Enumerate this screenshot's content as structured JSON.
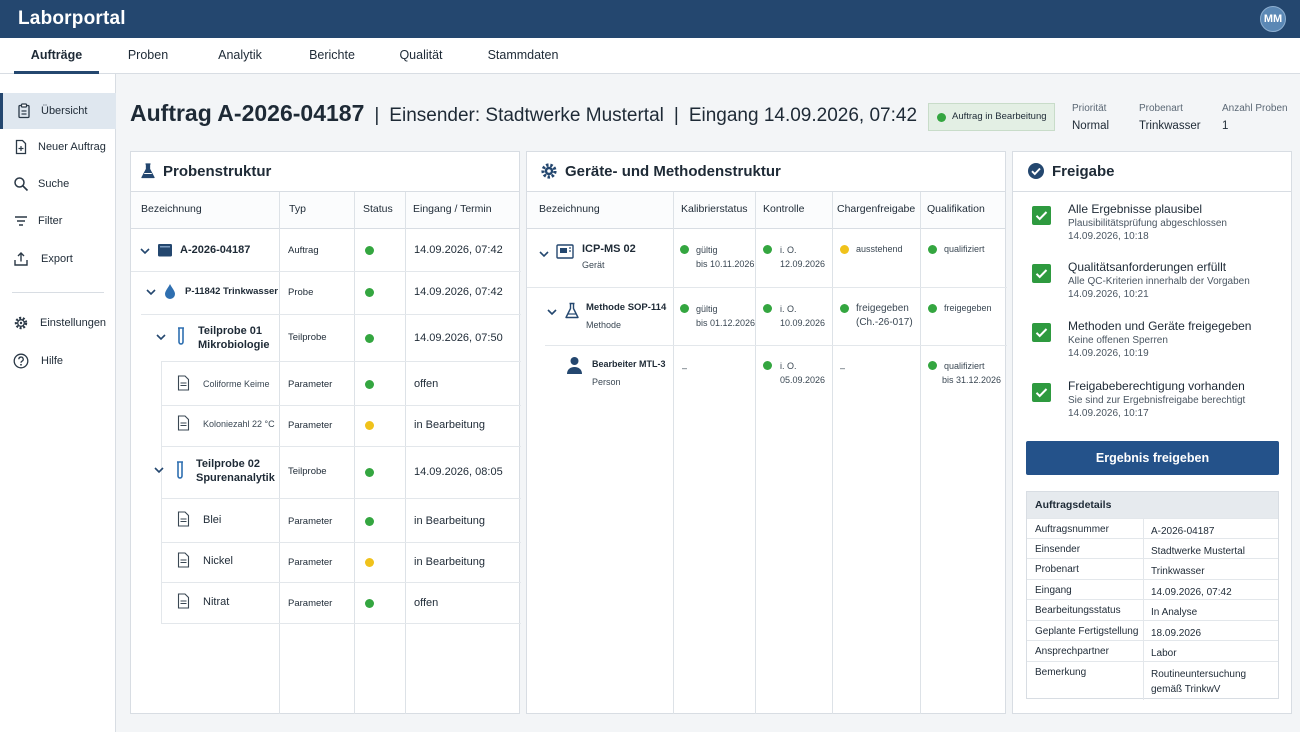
{
  "app": {
    "title": "Laborportal",
    "user_initials": "MM"
  },
  "nav": {
    "tabs": [
      {
        "label": "Aufträge"
      },
      {
        "label": "Proben"
      },
      {
        "label": "Analytik"
      },
      {
        "label": "Berichte"
      },
      {
        "label": "Qualität"
      },
      {
        "label": "Stammdaten"
      }
    ]
  },
  "sidebar": {
    "items": [
      {
        "label": "Übersicht",
        "icon": "clipboard-icon"
      },
      {
        "label": "Neuer Auftrag",
        "icon": "document-add-icon"
      },
      {
        "label": "Suche",
        "icon": "search-icon"
      },
      {
        "label": "Filter",
        "icon": "filter-icon"
      },
      {
        "label": "Export",
        "icon": "export-icon"
      },
      {
        "label": "Einstellungen",
        "icon": "gear-icon"
      },
      {
        "label": "Hilfe",
        "icon": "help-icon"
      }
    ]
  },
  "header": {
    "title": "Auftrag A-2026-04187",
    "sender": "Einsender: Stadtwerke Mustertal",
    "receipt": "Eingang 14.09.2026, 07:42",
    "sep": "|",
    "status": "Auftrag in Bearbeitung",
    "meta": [
      {
        "key": "Priorität",
        "value": "Normal"
      },
      {
        "key": "Probenart",
        "value": "Trinkwasser"
      },
      {
        "key": "Anzahl Proben",
        "value": "1"
      }
    ]
  },
  "probenstruktur": {
    "title": "Probenstruktur",
    "columns": [
      "Bezeichnung",
      "Typ",
      "Status",
      "Eingang / Termin"
    ],
    "rows": [
      {
        "name": "A-2026-04187",
        "type": "Auftrag",
        "status": "green",
        "date": "14.09.2026, 07:42"
      },
      {
        "name": "P-11842 Trinkwasser",
        "type": "Probe",
        "status": "green",
        "date": "14.09.2026, 07:42"
      },
      {
        "name": "Teilprobe 01",
        "name2": "Mikrobiologie",
        "type": "Teilprobe",
        "status": "green",
        "date": "14.09.2026, 07:50"
      },
      {
        "name": "Coliforme Keime",
        "type": "Parameter",
        "status": "green",
        "date": "offen"
      },
      {
        "name": "Koloniezahl 22 °C",
        "type": "Parameter",
        "status": "yellow",
        "date": "in Bearbeitung"
      },
      {
        "name": "Teilprobe 02",
        "name2": "Spurenanalytik",
        "type": "Teilprobe",
        "status": "green",
        "date": "14.09.2026, 08:05"
      },
      {
        "name": "Blei",
        "type": "Parameter",
        "status": "green",
        "date": "in Bearbeitung"
      },
      {
        "name": "Nickel",
        "type": "Parameter",
        "status": "yellow",
        "date": "in Bearbeitung"
      },
      {
        "name": "Nitrat",
        "type": "Parameter",
        "status": "green",
        "date": "offen"
      }
    ]
  },
  "geraete": {
    "title": "Geräte- und Methodenstruktur",
    "columns": [
      "Bezeichnung",
      "Kalibrierstatus",
      "Kontrolle",
      "Chargenfreigabe",
      "Qualifikation"
    ],
    "rows": [
      {
        "name": "ICP-MS 02",
        "sub": "Gerät",
        "kal": "gültig",
        "kal2": "bis 10.11.2026",
        "kal_status": "green",
        "kon": "i. O.",
        "kon2": "12.09.2026",
        "kon_status": "green",
        "ch": "ausstehend",
        "ch2": "",
        "ch_status": "yellow",
        "qual": "qualifiziert",
        "qual2": "",
        "qual_status": "green"
      },
      {
        "name": "Methode SOP-114",
        "sub": "Methode",
        "kal": "gültig",
        "kal2": "bis 01.12.2026",
        "kal_status": "green",
        "kon": "i. O.",
        "kon2": "10.09.2026",
        "kon_status": "green",
        "ch": "freigegeben",
        "ch2": "(Ch.-26-017)",
        "ch_status": "green",
        "qual": "freigegeben",
        "qual2": "",
        "qual_status": "green"
      },
      {
        "name": "Bearbeiter MTL-3",
        "sub": "Person",
        "kal": "–",
        "kal2": "",
        "kon": "i. O.",
        "kon2": "05.09.2026",
        "kon_status": "green",
        "ch": "–",
        "ch2": "",
        "qual": "qualifiziert",
        "qual2": "bis 31.12.2026",
        "qual_status": "green"
      }
    ]
  },
  "freigabe": {
    "title": "Freigabe",
    "checks": [
      {
        "title": "Alle Ergebnisse plausibel",
        "desc": "Plausibilitätsprüfung abgeschlossen",
        "date": "14.09.2026, 10:18"
      },
      {
        "title": "Qualitätsanforderungen erfüllt",
        "desc": "Alle QC-Kriterien innerhalb der Vorgaben",
        "date": "14.09.2026, 10:21"
      },
      {
        "title": "Methoden und Geräte freigegeben",
        "desc": "Keine offenen Sperren",
        "date": "14.09.2026, 10:19"
      },
      {
        "title": "Freigabeberechtigung vorhanden",
        "desc": "Sie sind zur Ergebnisfreigabe berechtigt",
        "date": "14.09.2026, 10:17"
      }
    ],
    "button": "Ergebnis freigeben",
    "details_title": "Auftragsdetails",
    "details": [
      {
        "k": "Auftragsnummer",
        "v": "A-2026-04187"
      },
      {
        "k": "Einsender",
        "v": "Stadtwerke Mustertal"
      },
      {
        "k": "Probenart",
        "v": "Trinkwasser"
      },
      {
        "k": "Eingang",
        "v": "14.09.2026, 07:42"
      },
      {
        "k": "Bearbeitungsstatus",
        "v": "In Analyse"
      },
      {
        "k": "Geplante Fertigstellung",
        "v": "18.09.2026"
      },
      {
        "k": "Ansprechpartner",
        "v": "Labor"
      },
      {
        "k": "Bemerkung",
        "v": "Routineuntersuchung",
        "v2": "gemäß TrinkwV"
      }
    ]
  },
  "colors": {
    "primary": "#24476f",
    "button": "#24528a",
    "ok": "#34a640",
    "warn": "#f0c21b"
  }
}
